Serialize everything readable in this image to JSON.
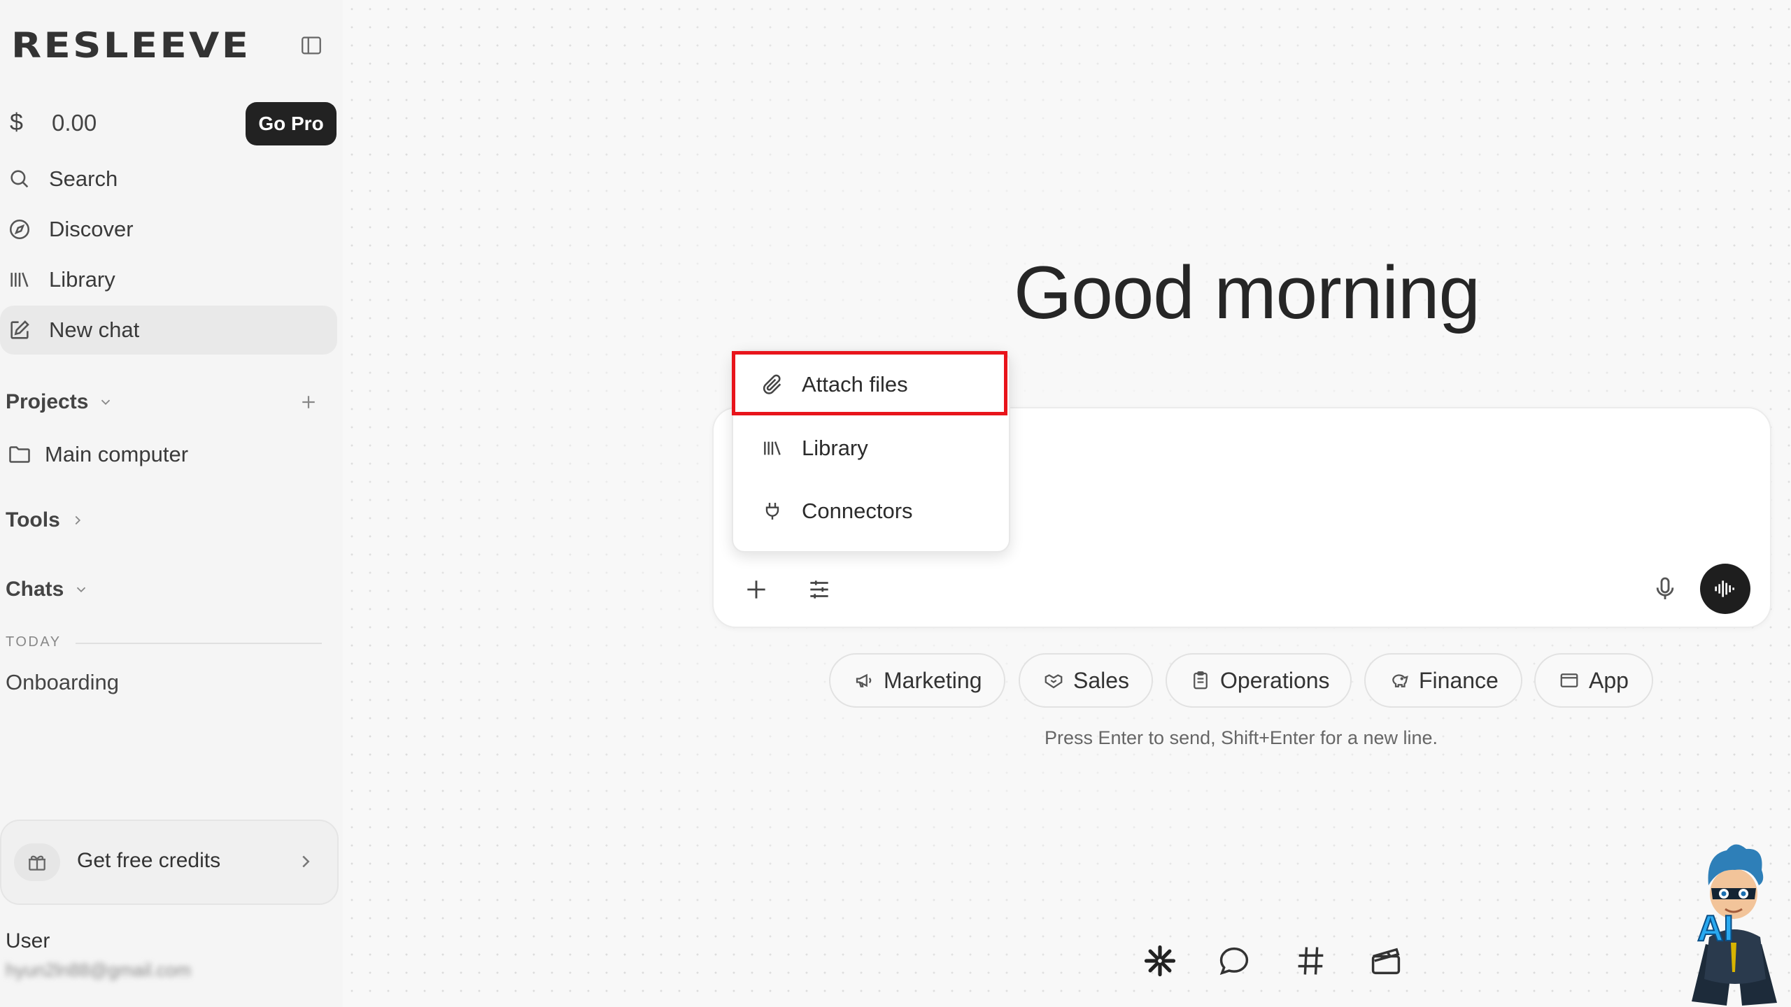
{
  "sidebar": {
    "logo": "RESLEEVE",
    "balance": {
      "currency": "$",
      "amount": "0.00",
      "upgrade_label": "Go Pro"
    },
    "nav": {
      "search": "Search",
      "discover": "Discover",
      "library": "Library",
      "new_chat": "New chat"
    },
    "projects": {
      "title": "Projects",
      "items": [
        "Main computer"
      ]
    },
    "tools": {
      "title": "Tools"
    },
    "chats": {
      "title": "Chats",
      "group_label": "TODAY",
      "items": [
        "Onboarding"
      ]
    },
    "credits": {
      "label": "Get free credits"
    },
    "user": {
      "name": "User",
      "email": "hyun2ln88@gmail.com"
    }
  },
  "main": {
    "greeting": "Good morning",
    "attach_menu": {
      "items": [
        "Attach files",
        "Library",
        "Connectors"
      ],
      "highlighted": "Attach files"
    },
    "chips": [
      "Marketing",
      "Sales",
      "Operations",
      "Finance",
      "App"
    ],
    "hint": "Press Enter to send, Shift+Enter for a new line."
  },
  "mascot": {
    "badge": "AI"
  },
  "colors": {
    "accent_dark": "#222222",
    "highlight_red": "#e8141b",
    "background": "#f8f8f8"
  }
}
